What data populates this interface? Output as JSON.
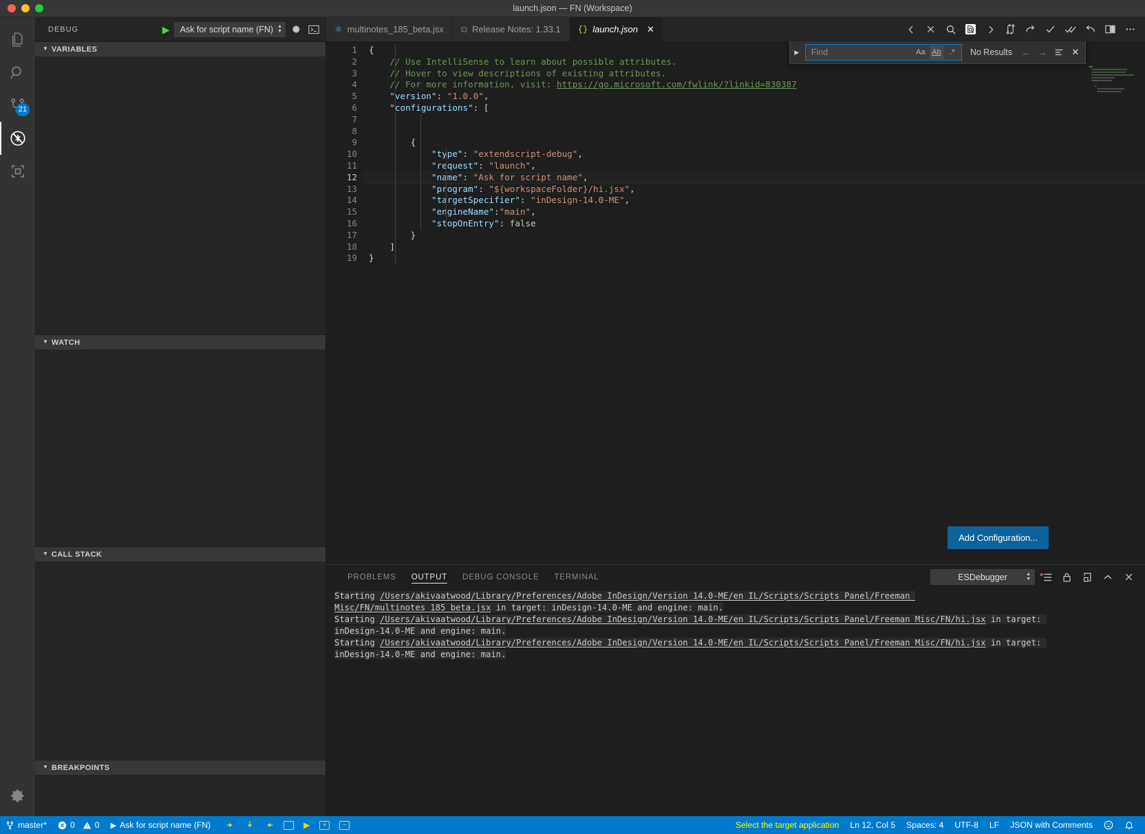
{
  "window": {
    "title": "launch.json — FN (Workspace)"
  },
  "activitybar": {
    "items": [
      {
        "name": "explorer",
        "icon": "files-icon",
        "badge": null
      },
      {
        "name": "search",
        "icon": "search-icon",
        "badge": null
      },
      {
        "name": "source-control",
        "icon": "source-control-icon",
        "badge": "21"
      },
      {
        "name": "debug",
        "icon": "debug-no-entry-icon",
        "badge": null
      },
      {
        "name": "extensions",
        "icon": "extensions-icon",
        "badge": null
      }
    ],
    "settings_icon": "gear-icon"
  },
  "sidebar": {
    "title": "DEBUG",
    "run_icon": "play-icon",
    "configuration": "Ask for script name (FN)",
    "settings_icon": "gear-icon",
    "open_console_icon": "terminal-icon",
    "sections": [
      {
        "label": "VARIABLES"
      },
      {
        "label": "WATCH"
      },
      {
        "label": "CALL STACK"
      },
      {
        "label": "BREAKPOINTS"
      }
    ]
  },
  "tabs": [
    {
      "label": "multinotes_185_beta.jsx",
      "icon": "jsx-file-icon",
      "active": false,
      "closable": false
    },
    {
      "label": "Release Notes: 1.33.1",
      "icon": "vscode-notes-icon",
      "active": false,
      "closable": false
    },
    {
      "label": "launch.json",
      "icon": "json-file-icon",
      "active": true,
      "closable": true
    }
  ],
  "editor_toolbar": [
    {
      "name": "previous-change",
      "icon": "chevron-left-icon",
      "glyph": "‹"
    },
    {
      "name": "close-diff",
      "icon": "close-icon",
      "glyph": "×"
    },
    {
      "name": "find",
      "icon": "search-icon",
      "glyph": "search"
    },
    {
      "name": "find-in-file",
      "icon": "file-search-icon",
      "glyph": "file-search"
    },
    {
      "name": "next-change",
      "icon": "chevron-right-icon",
      "glyph": "›"
    },
    {
      "name": "compare-changes",
      "icon": "compare-icon",
      "glyph": "compare"
    },
    {
      "name": "redo-change",
      "icon": "redo-icon",
      "glyph": "redo"
    },
    {
      "name": "stage-change",
      "icon": "check-icon",
      "glyph": "check"
    },
    {
      "name": "stage-all",
      "icon": "double-check-icon",
      "glyph": "double-check"
    },
    {
      "name": "undo-change",
      "icon": "undo-icon",
      "glyph": "undo"
    },
    {
      "name": "split-editor",
      "icon": "split-editor-icon",
      "glyph": "split"
    },
    {
      "name": "more-actions",
      "icon": "ellipsis-icon",
      "glyph": "⋯"
    }
  ],
  "find_widget": {
    "expand_icon": "chevron-right-icon",
    "placeholder": "Find",
    "value": "",
    "options": [
      {
        "name": "match-case",
        "label": "Aa",
        "active": false
      },
      {
        "name": "match-whole-word",
        "label": "Ab",
        "active": true
      },
      {
        "name": "use-regex",
        "label": ".*",
        "active": false
      }
    ],
    "status": "No Results",
    "prev_label": "←",
    "next_label": "→",
    "selection_icon": "find-in-selection-icon",
    "close_icon": "close-icon"
  },
  "editor": {
    "language_note": "JSON with Comments",
    "current_line": 12,
    "total_lines": 19,
    "lines": [
      {
        "n": 1,
        "tokens": [
          {
            "t": "punc",
            "s": "{"
          }
        ]
      },
      {
        "n": 2,
        "indent": 1,
        "tokens": [
          {
            "t": "com",
            "s": "// Use IntelliSense to learn about possible attributes."
          }
        ]
      },
      {
        "n": 3,
        "indent": 1,
        "tokens": [
          {
            "t": "com",
            "s": "// Hover to view descriptions of existing attributes."
          }
        ]
      },
      {
        "n": 4,
        "indent": 1,
        "tokens": [
          {
            "t": "com",
            "s": "// For more information, visit: "
          },
          {
            "t": "link",
            "s": "https://go.microsoft.com/fwlink/?linkid=830387"
          }
        ]
      },
      {
        "n": 5,
        "indent": 1,
        "tokens": [
          {
            "t": "key",
            "s": "\"version\""
          },
          {
            "t": "punc",
            "s": ": "
          },
          {
            "t": "str",
            "s": "\"1.0.0\""
          },
          {
            "t": "punc",
            "s": ","
          }
        ]
      },
      {
        "n": 6,
        "indent": 1,
        "tokens": [
          {
            "t": "key",
            "s": "\"configurations\""
          },
          {
            "t": "punc",
            "s": ": ["
          }
        ]
      },
      {
        "n": 7,
        "indent": 1,
        "tokens": []
      },
      {
        "n": 8,
        "indent": 1,
        "tokens": []
      },
      {
        "n": 9,
        "indent": 2,
        "tokens": [
          {
            "t": "punc",
            "s": "{"
          }
        ]
      },
      {
        "n": 10,
        "indent": 3,
        "tokens": [
          {
            "t": "key",
            "s": "\"type\""
          },
          {
            "t": "punc",
            "s": ": "
          },
          {
            "t": "str",
            "s": "\"extendscript-debug\""
          },
          {
            "t": "punc",
            "s": ","
          }
        ]
      },
      {
        "n": 11,
        "indent": 3,
        "tokens": [
          {
            "t": "key",
            "s": "\"request\""
          },
          {
            "t": "punc",
            "s": ": "
          },
          {
            "t": "str",
            "s": "\"launch\""
          },
          {
            "t": "punc",
            "s": ","
          }
        ]
      },
      {
        "n": 12,
        "indent": 3,
        "highlight": true,
        "tokens": [
          {
            "t": "key",
            "s": "\"name\""
          },
          {
            "t": "punc",
            "s": ": "
          },
          {
            "t": "str",
            "s": "\"Ask for script name\""
          },
          {
            "t": "punc",
            "s": ","
          }
        ]
      },
      {
        "n": 13,
        "indent": 3,
        "tokens": [
          {
            "t": "key",
            "s": "\"program\""
          },
          {
            "t": "punc",
            "s": ": "
          },
          {
            "t": "str",
            "s": "\"${workspaceFolder}/hi.jsx\""
          },
          {
            "t": "punc",
            "s": ","
          }
        ]
      },
      {
        "n": 14,
        "indent": 3,
        "tokens": [
          {
            "t": "key",
            "s": "\"targetSpecifier\""
          },
          {
            "t": "punc",
            "s": ": "
          },
          {
            "t": "str",
            "s": "\"inDesign-14.0-ME\""
          },
          {
            "t": "punc",
            "s": ","
          }
        ]
      },
      {
        "n": 15,
        "indent": 3,
        "tokens": [
          {
            "t": "key",
            "s": "\"engineName\""
          },
          {
            "t": "punc",
            "s": ":"
          },
          {
            "t": "str",
            "s": "\"main\""
          },
          {
            "t": "punc",
            "s": ","
          }
        ]
      },
      {
        "n": 16,
        "indent": 3,
        "tokens": [
          {
            "t": "key",
            "s": "\"stopOnEntry\""
          },
          {
            "t": "punc",
            "s": ": "
          },
          {
            "t": "num",
            "s": "false"
          }
        ]
      },
      {
        "n": 17,
        "indent": 2,
        "tokens": [
          {
            "t": "punc",
            "s": "}"
          }
        ]
      },
      {
        "n": 18,
        "indent": 1,
        "tokens": [
          {
            "t": "punc",
            "s": "]"
          }
        ]
      },
      {
        "n": 19,
        "indent": 0,
        "tokens": [
          {
            "t": "punc",
            "s": "}"
          }
        ]
      }
    ],
    "add_configuration_label": "Add Configuration..."
  },
  "panel": {
    "tabs": [
      {
        "label": "PROBLEMS",
        "active": false
      },
      {
        "label": "OUTPUT",
        "active": true
      },
      {
        "label": "DEBUG CONSOLE",
        "active": false
      },
      {
        "label": "TERMINAL",
        "active": false
      }
    ],
    "channel": "ESDebugger",
    "actions": [
      {
        "name": "clear-output",
        "icon": "clear-output-icon"
      },
      {
        "name": "lock-scroll",
        "icon": "lock-icon"
      },
      {
        "name": "open-in-editor",
        "icon": "open-editor-icon"
      },
      {
        "name": "maximize-panel",
        "icon": "chevron-up-icon"
      },
      {
        "name": "close-panel",
        "icon": "close-icon"
      }
    ],
    "output": [
      {
        "prefix": "Starting ",
        "path": "/Users/akivaatwood/Library/Preferences/Adobe InDesign/Version 14.0-ME/en_IL/Scripts/Scripts Panel/Freeman Misc/FN/multinotes_185_beta.jsx",
        "suffix": " in target: inDesign-14.0-ME and engine: main."
      },
      {
        "prefix": "Starting ",
        "path": "/Users/akivaatwood/Library/Preferences/Adobe InDesign/Version 14.0-ME/en_IL/Scripts/Scripts Panel/Freeman Misc/FN/hi.jsx",
        "suffix": " in target: inDesign-14.0-ME and engine: main."
      },
      {
        "prefix": "Starting ",
        "path": "/Users/akivaatwood/Library/Preferences/Adobe InDesign/Version 14.0-ME/en_IL/Scripts/Scripts Panel/Freeman Misc/FN/hi.jsx",
        "suffix": " in target: inDesign-14.0-ME and engine: main."
      }
    ]
  },
  "statusbar": {
    "branch": "master*",
    "branch_icon": "source-control-icon",
    "errors": "0",
    "warnings": "0",
    "error_icon": "error-circle-icon",
    "warning_icon": "warning-triangle-icon",
    "debug_config": "Ask for script name (FN)",
    "debug_play_icon": "play-icon",
    "debug_controls": [
      {
        "name": "step-over",
        "icon": "step-over-icon"
      },
      {
        "name": "step-into",
        "icon": "step-into-icon"
      },
      {
        "name": "step-out",
        "icon": "step-out-icon"
      },
      {
        "name": "stop-debug",
        "icon": "stop-icon"
      },
      {
        "name": "continue",
        "icon": "continue-icon"
      },
      {
        "name": "expand-all",
        "icon": "plus-box-icon"
      },
      {
        "name": "collapse-all",
        "icon": "minus-box-icon"
      }
    ],
    "target_message": "Select the target application",
    "cursor": "Ln 12, Col 5",
    "indentation": "Spaces: 4",
    "encoding": "UTF-8",
    "eol": "LF",
    "language": "JSON with Comments",
    "feedback_icon": "smiley-icon",
    "notifications_icon": "bell-icon"
  },
  "colors": {
    "accent": "#007acc",
    "status_warn": "#ffff00",
    "button": "#0e639c",
    "badge": "#007acc"
  }
}
